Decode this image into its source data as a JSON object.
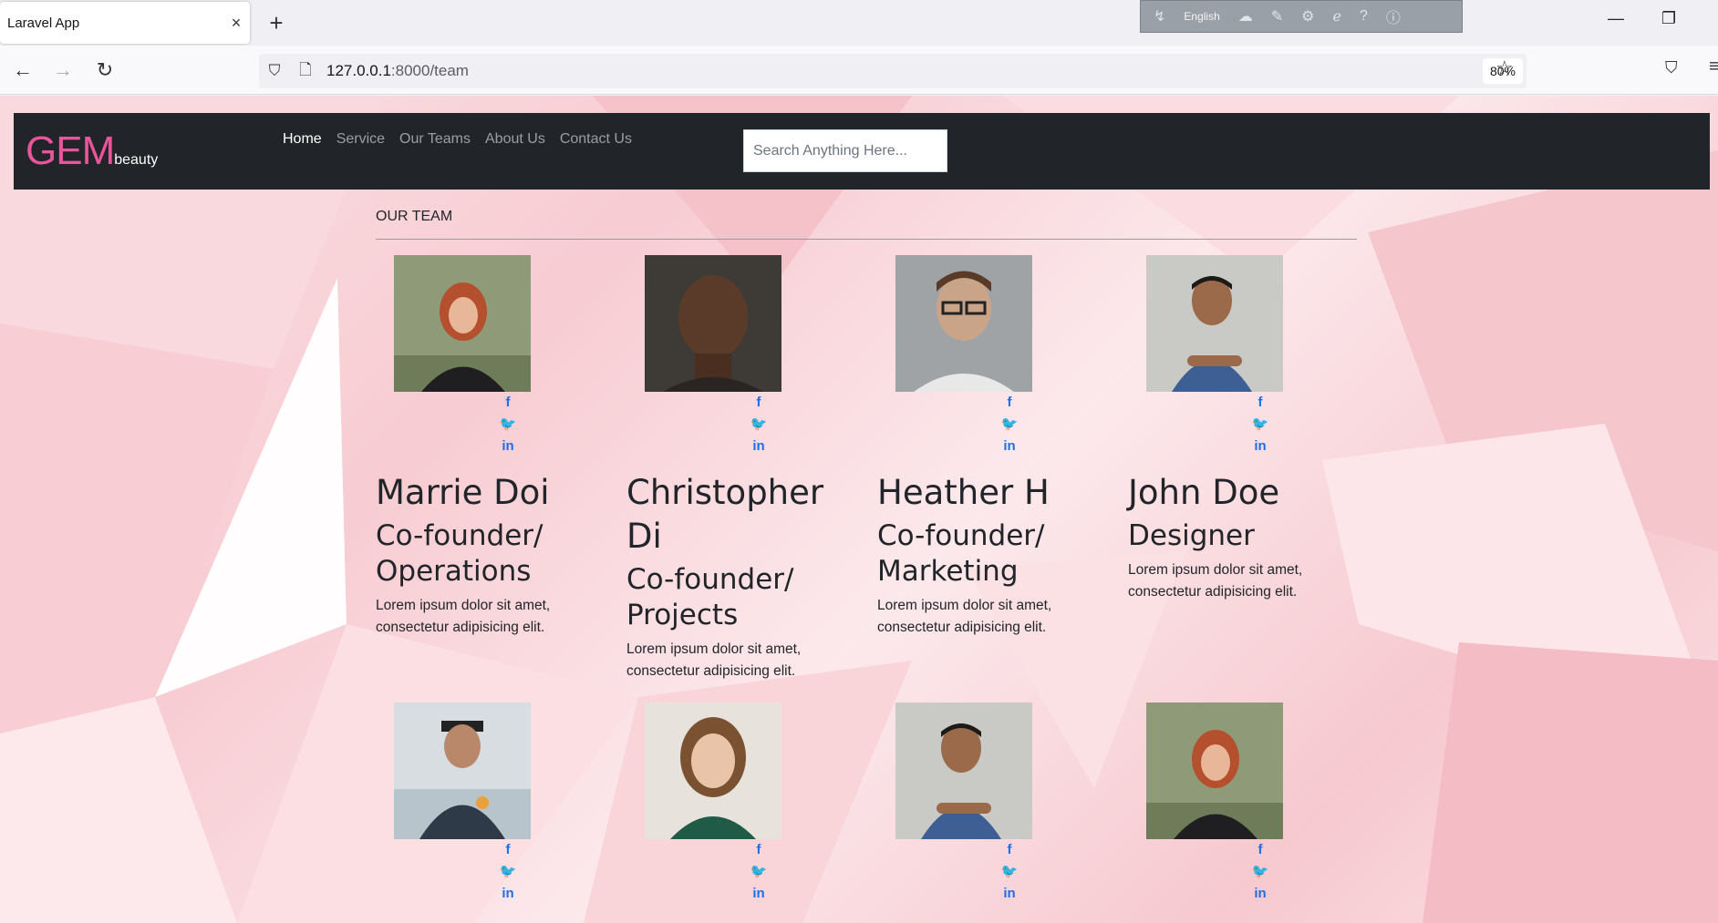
{
  "browser": {
    "tab_title": "Laravel App",
    "tab_close": "×",
    "new_tab": "+",
    "ext_language": "English",
    "url_host": "127.0.0.1",
    "url_rest": ":8000/team",
    "zoom": "80%",
    "window_minimize": "—",
    "window_restore": "❐",
    "icons": [
      "back-icon",
      "forward-icon",
      "reload-icon",
      "shield-icon",
      "page-icon",
      "star-icon",
      "pocket-icon",
      "menu-icon"
    ]
  },
  "site": {
    "brand_main": "GEM",
    "brand_sub": "beauty",
    "brand_color": "#e8559a",
    "nav": [
      "Home",
      "Service",
      "Our Teams",
      "About Us",
      "Contact Us"
    ],
    "search_placeholder": "Search Anything Here..."
  },
  "team": {
    "heading": "OUR TEAM",
    "social_labels": [
      "f",
      "🐦",
      "in"
    ],
    "members": [
      {
        "name": "Marrie Doi",
        "role": "Co-founder/ Operations",
        "bio": "Lorem ipsum dolor sit amet, consectetur adipisicing elit.",
        "photo": "woman-red-hair"
      },
      {
        "name": "Christopher Di",
        "role": "Co-founder/ Projects",
        "bio": "Lorem ipsum dolor sit amet, consectetur adipisicing elit.",
        "photo": "man-bald"
      },
      {
        "name": "Heather H",
        "role": "Co-founder/ Marketing",
        "bio": "Lorem ipsum dolor sit amet, consectetur adipisicing elit.",
        "photo": "man-glasses"
      },
      {
        "name": "John Doe",
        "role": "Designer",
        "bio": "Lorem ipsum dolor sit amet, consectetur adipisicing elit.",
        "photo": "man-blue-shirt"
      },
      {
        "photo": "man-cap"
      },
      {
        "photo": "woman-smiling"
      },
      {
        "photo": "man-blue-shirt"
      },
      {
        "photo": "woman-red-hair"
      }
    ]
  }
}
